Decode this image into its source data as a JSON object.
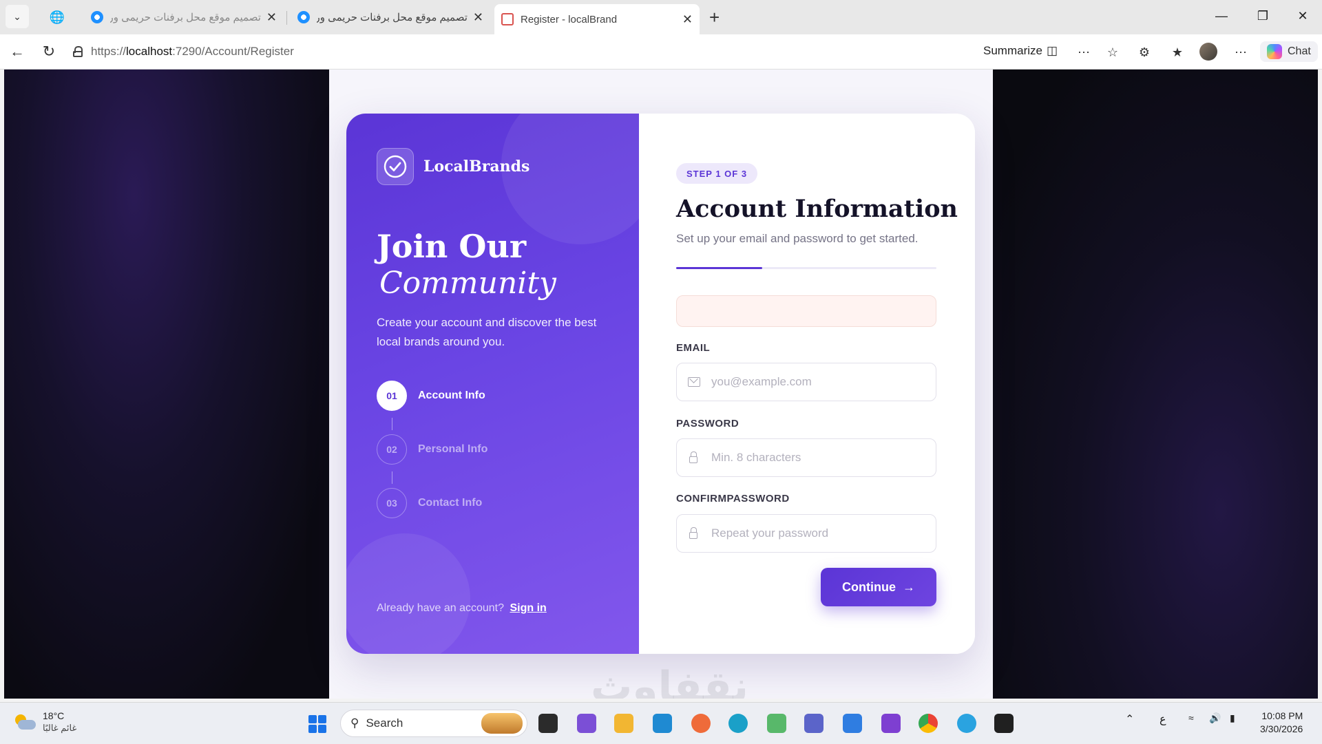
{
  "browser": {
    "tabs": [
      {
        "title": "تصميم موقع محل برفنات حريمى ور",
        "active": false
      },
      {
        "title": "تصميم موقع محل برفنات حريمى ور",
        "active": false
      },
      {
        "title": "Register - localBrand",
        "active": true
      }
    ],
    "url_prefix": "https://",
    "url_host": "localhost",
    "url_rest": ":7290/Account/Register",
    "summarize_label": "Summarize",
    "chat_label": "Chat"
  },
  "brand": {
    "name": "LocalBrands"
  },
  "hero": {
    "title_line1": "Join Our",
    "title_line2": "Community",
    "description": "Create your account and discover the best local brands around you."
  },
  "steps": [
    {
      "num": "01",
      "label": "Account Info",
      "active": true
    },
    {
      "num": "02",
      "label": "Personal Info",
      "active": false
    },
    {
      "num": "03",
      "label": "Contact Info",
      "active": false
    }
  ],
  "signin": {
    "prompt": "Already have an account?",
    "link": "Sign in"
  },
  "form": {
    "step_badge": "STEP 1 OF 3",
    "title": "Account Information",
    "subtitle": "Set up your email and password to get started.",
    "progress_fraction": 0.33,
    "email_label": "EMAIL",
    "email_placeholder": "you@example.com",
    "password_label": "PASSWORD",
    "password_placeholder": "Min. 8 characters",
    "confirm_label": "CONFIRMPASSWORD",
    "confirm_placeholder": "Repeat your password",
    "continue_label": "Continue"
  },
  "watermark": "نقفاوث",
  "taskbar": {
    "weather_temp": "18°C",
    "weather_desc": "غائم غالبًا",
    "search_label": "Search",
    "lang": "ع",
    "time": "10:08 PM",
    "date": "3/30/2026"
  },
  "colors": {
    "accent": "#5b35d6",
    "accent_light": "#ede8fb"
  }
}
